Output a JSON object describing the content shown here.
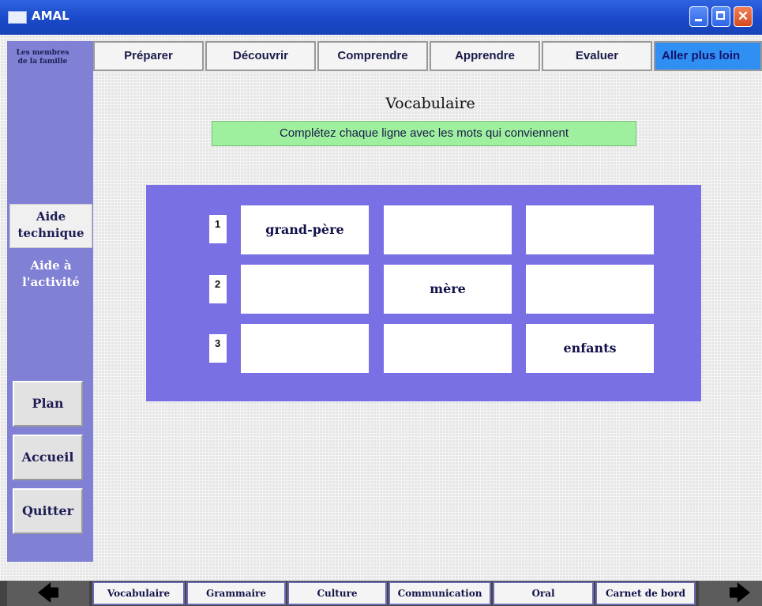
{
  "window": {
    "title": "AMAL"
  },
  "sidebar": {
    "theme_label": "Les membres de la famille",
    "aide_technique": "Aide technique",
    "aide_activite": "Aide à l'activité",
    "plan": "Plan",
    "accueil": "Accueil",
    "quitter": "Quitter"
  },
  "top_tabs": [
    {
      "label": "Préparer"
    },
    {
      "label": "Découvrir"
    },
    {
      "label": "Comprendre"
    },
    {
      "label": "Apprendre"
    },
    {
      "label": "Evaluer"
    },
    {
      "label": "Aller plus loin",
      "active": true
    }
  ],
  "main": {
    "heading": "Vocabulaire",
    "instruction": "Complétez chaque ligne avec les mots qui conviennent"
  },
  "exercise": {
    "rows": [
      {
        "number": "1",
        "cells": [
          "grand-père",
          "",
          ""
        ]
      },
      {
        "number": "2",
        "cells": [
          "",
          "mère",
          ""
        ]
      },
      {
        "number": "3",
        "cells": [
          "",
          "",
          "enfants"
        ]
      }
    ]
  },
  "bottom_tabs": [
    {
      "label": "Vocabulaire"
    },
    {
      "label": "Grammaire"
    },
    {
      "label": "Culture"
    },
    {
      "label": "Communication"
    },
    {
      "label": "Oral"
    },
    {
      "label": "Carnet de bord"
    }
  ],
  "icons": {
    "prev": "left-arrow-icon",
    "next": "right-arrow-icon"
  }
}
